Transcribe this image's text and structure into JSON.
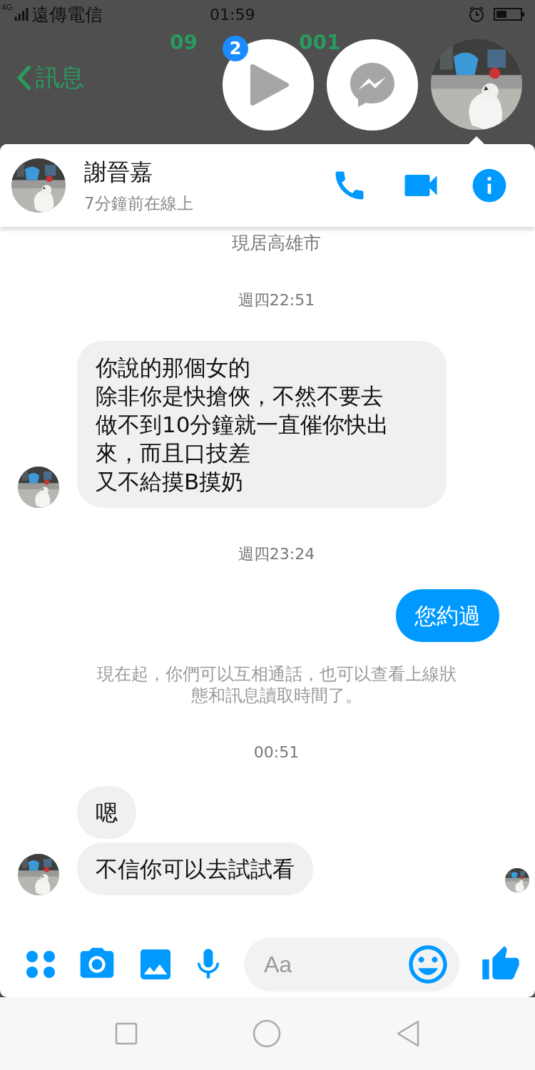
{
  "status_bar": {
    "network": "4G",
    "carrier": "遠傳電信",
    "time": "01:59"
  },
  "background_app": {
    "back": "訊息",
    "title_parts": [
      "09",
      "001"
    ]
  },
  "chat_heads": {
    "badge": "2"
  },
  "conversation": {
    "name": "謝晉嘉",
    "status": "7分鐘前在線上"
  },
  "messages": [
    {
      "kind": "info",
      "text": "現居高雄市"
    },
    {
      "kind": "time",
      "text": "週四22:51"
    },
    {
      "kind": "incoming",
      "bubbles": [
        {
          "lines": [
            "你說的那個女的",
            "除非你是快搶俠，不然不要去",
            "做不到10分鐘就一直催你快出來，而且口技差",
            "又不給摸B摸奶"
          ]
        }
      ]
    },
    {
      "kind": "time",
      "text": "週四23:24"
    },
    {
      "kind": "outgoing",
      "bubbles": [
        {
          "lines": [
            "您約過"
          ]
        }
      ]
    },
    {
      "kind": "notice",
      "text": "現在起，你們可以互相通話，也可以查看上線狀態和訊息讀取時間了。"
    },
    {
      "kind": "time",
      "text": "00:51"
    },
    {
      "kind": "incoming",
      "bubbles": [
        {
          "lines": [
            "嗯"
          ]
        },
        {
          "lines": [
            "不信你可以去試試看"
          ]
        }
      ],
      "seen": true
    }
  ],
  "composer": {
    "placeholder": "Aa"
  }
}
